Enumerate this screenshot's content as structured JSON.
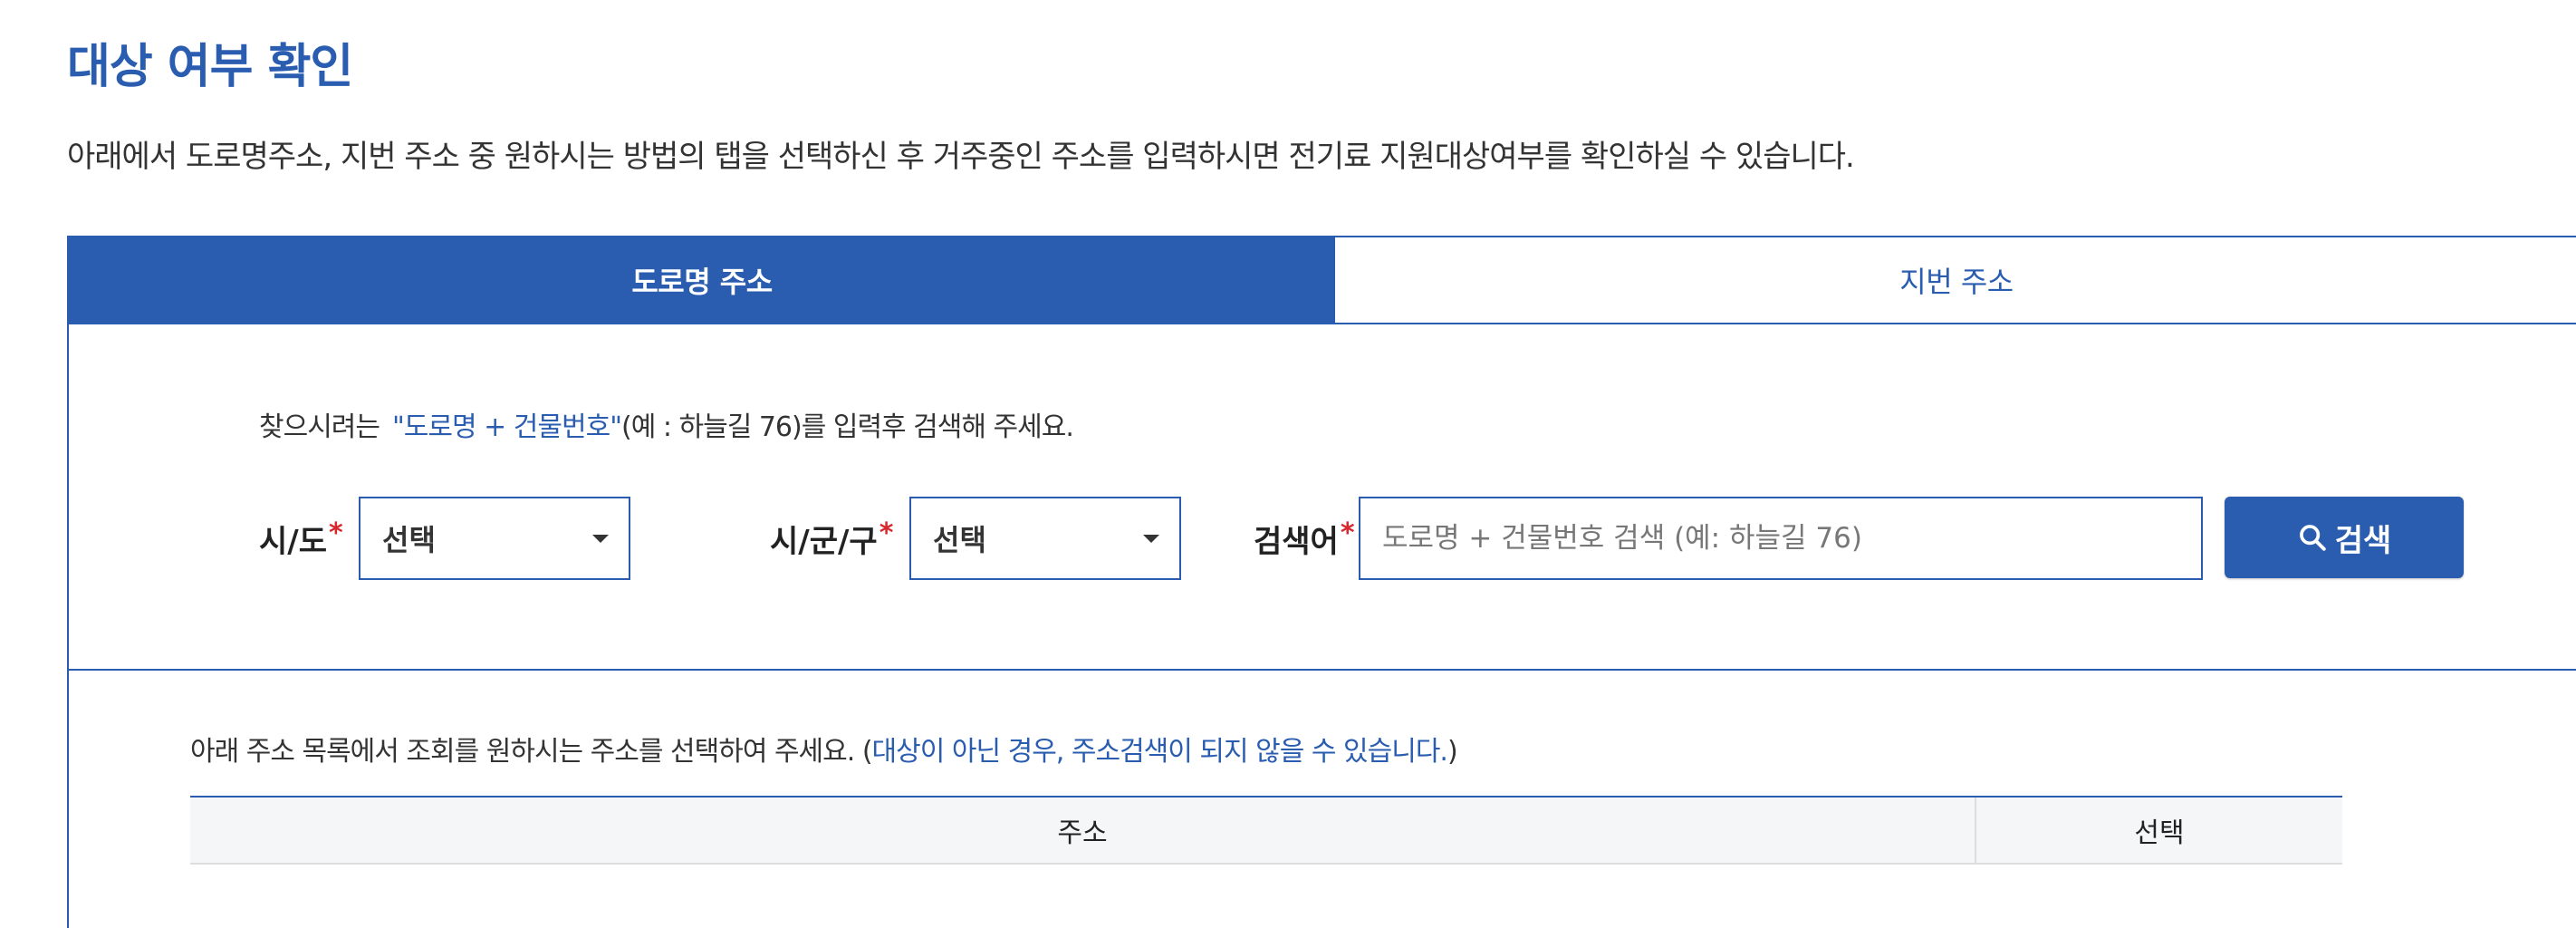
{
  "page": {
    "title": "대상 여부 확인",
    "description": "아래에서 도로명주소, 지번 주소 중 원하시는 방법의 탭을 선택하신 후 거주중인 주소를 입력하시면 전기료 지원대상여부를 확인하실 수 있습니다."
  },
  "tabs": [
    {
      "label": "도로명 주소",
      "active": true
    },
    {
      "label": "지번 주소",
      "active": false
    }
  ],
  "search": {
    "guide_prefix": "찾으시려는",
    "guide_highlight": "\"도로명 + 건물번호\"",
    "guide_suffix": "(예 : 하늘길 76)를 입력후 검색해 주세요.",
    "sido_label": "시/도",
    "sido_value": "선택",
    "sigungu_label": "시/군/구",
    "sigungu_value": "선택",
    "keyword_label": "검색어",
    "required_mark": "*",
    "keyword_placeholder": "도로명 + 건물번호 검색 (예: 하늘길 76)",
    "button_label": "검색"
  },
  "results": {
    "guide_text": "아래 주소 목록에서 조회를 원하시는 주소를 선택하여 주세요. (",
    "guide_highlight": "대상이 아닌 경우, 주소검색이 되지 않을 수 있습니다.",
    "guide_close": ")",
    "columns": [
      "주소",
      "선택"
    ]
  },
  "colors": {
    "primary": "#2a5db0",
    "required": "#d8262f",
    "header_bg": "#f5f6f8"
  },
  "icons": {
    "search_button": "search-icon",
    "select_caret": "caret-down-icon"
  }
}
